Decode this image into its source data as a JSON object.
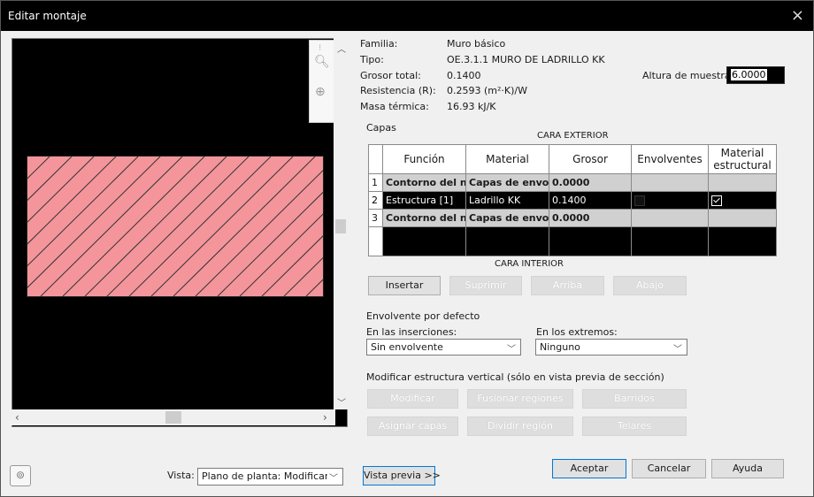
{
  "window": {
    "title": "Editar montaje",
    "close_glyph": "×"
  },
  "properties": [
    {
      "label": "Familia:",
      "value": "Muro básico"
    },
    {
      "label": "Tipo:",
      "value": "OE.3.1.1 MURO DE LADRILLO KK"
    },
    {
      "label": "Grosor total:",
      "value": "0.1400"
    },
    {
      "label": "Resistencia (R):",
      "value": "0.2593 (m²·K)/W"
    },
    {
      "label": "Masa térmica:",
      "value": "16.93 kJ/K"
    }
  ],
  "sample_height": {
    "label": "Altura de muestra:",
    "value": "6.0000"
  },
  "layers": {
    "title": "Capas",
    "exterior_label": "CARA EXTERIOR",
    "interior_label": "CARA INTERIOR",
    "headers": [
      "Función",
      "Material",
      "Grosor",
      "Envolventes",
      "Material estructural"
    ],
    "rows": [
      {
        "num": "1",
        "function": "Contorno del núcleo",
        "material": "Capas de envolvente",
        "thickness": "0.0000"
      },
      {
        "num": "2",
        "function": "Estructura [1]",
        "material": "Ladrillo KK",
        "thickness": "0.1400"
      },
      {
        "num": "3",
        "function": "Contorno del núcleo",
        "material": "Capas de envolvente",
        "thickness": "0.0000"
      }
    ]
  },
  "layer_buttons": {
    "insert": "Insertar",
    "delete": "Suprimir",
    "up": "Arriba",
    "down": "Abajo"
  },
  "wrapping": {
    "title": "Envolvente por defecto",
    "inserts_label": "En las inserciones:",
    "inserts_value": "Sin envolvente",
    "ends_label": "En los extremos:",
    "ends_value": "Ninguno"
  },
  "vertical": {
    "title": "Modificar estructura vertical (sólo en vista previa de sección)",
    "modify": "Modificar",
    "merge": "Fusionar regiones",
    "sweeps": "Barridos",
    "assign": "Asignar capas",
    "split": "Dividir región",
    "reveals": "Telares"
  },
  "footer": {
    "view_label": "Vista:",
    "view_value": "Plano de planta: Modificar atributos",
    "preview_button": "Vista previa >>",
    "ok": "Aceptar",
    "cancel": "Cancelar",
    "help": "Ayuda"
  },
  "icons": [
    "zoom-icon",
    "zoom-window-icon",
    "steering-wheel-icon"
  ],
  "colors": {
    "wall_fill": "#f4959b",
    "accent": "#0078d7"
  }
}
